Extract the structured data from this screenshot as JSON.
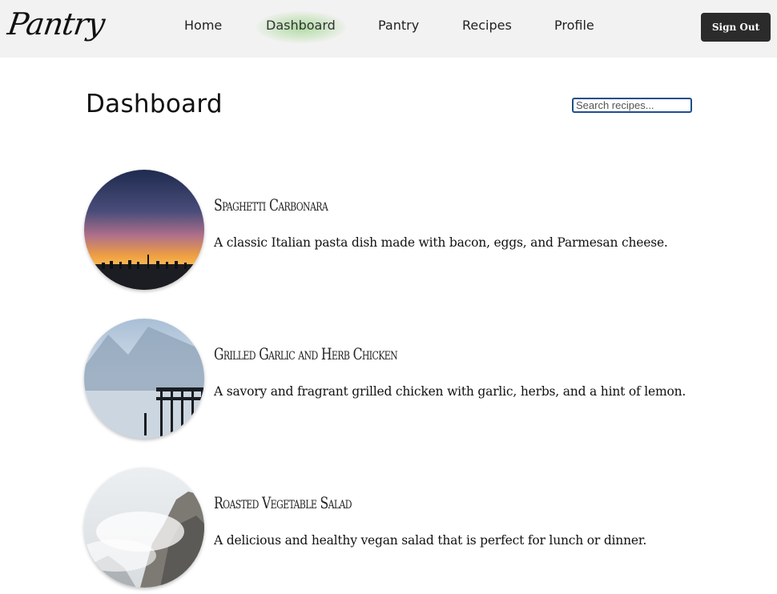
{
  "header": {
    "logo": "Pantry",
    "nav": [
      {
        "label": "Home"
      },
      {
        "label": "Dashboard"
      },
      {
        "label": "Pantry"
      },
      {
        "label": "Recipes"
      },
      {
        "label": "Profile"
      }
    ],
    "active_nav": "Dashboard",
    "sign_out_label": "Sign Out"
  },
  "main": {
    "title": "Dashboard",
    "search": {
      "value": "",
      "placeholder": "Search recipes..."
    },
    "recipes": [
      {
        "title": "Spaghetti Carbonara",
        "description": "A classic Italian pasta dish made with bacon, eggs, and Parmesan cheese."
      },
      {
        "title": "Grilled Garlic and Herb Chicken",
        "description": "A savory and fragrant grilled chicken with garlic, herbs, and a hint of lemon."
      },
      {
        "title": "Roasted Vegetable Salad",
        "description": "A delicious and healthy vegan salad that is perfect for lunch or dinner."
      }
    ]
  },
  "colors": {
    "nav_background": "#f2f2f2",
    "active_glow": "#a6d98c",
    "sign_out_background": "#2b2b2b",
    "search_border": "#1f4f8a"
  }
}
